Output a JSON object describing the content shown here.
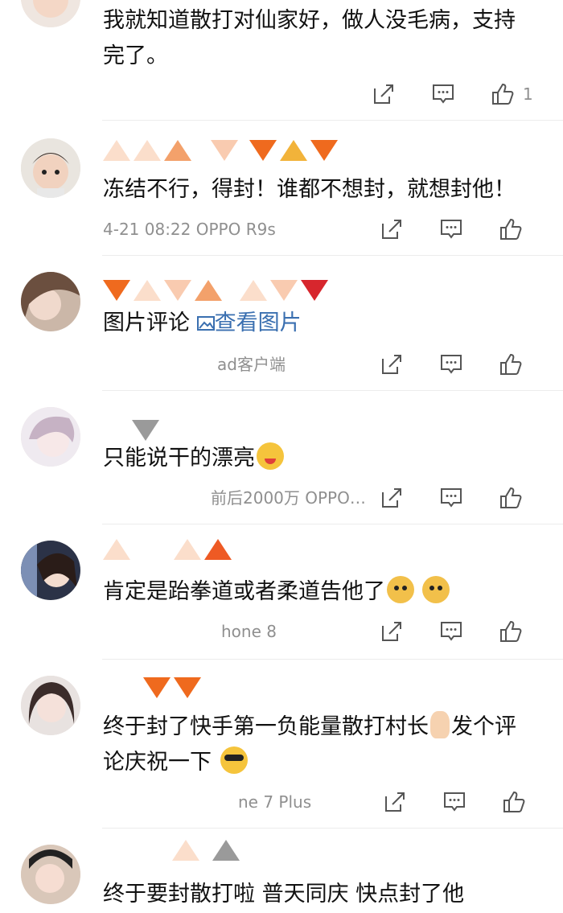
{
  "comments": [
    {
      "text_lines": [
        "我就知道散打对仙家好，做人没毛病，支持",
        "完了。"
      ],
      "meta": "",
      "like_count": "1"
    },
    {
      "text_lines": [
        "冻结不行，得封！谁都不想封，就想封他！"
      ],
      "meta": "4-21 08:22  OPPO R9s",
      "like_count": ""
    },
    {
      "text_lines": [
        "图片评论"
      ],
      "link_text": "查看图片",
      "meta": "ad客户端",
      "like_count": ""
    },
    {
      "text_lines": [
        "只能说干的漂亮"
      ],
      "meta": "前后2000万  OPPO…",
      "like_count": ""
    },
    {
      "text_lines": [
        "肯定是跆拳道或者柔道告他了"
      ],
      "meta": "hone 8",
      "like_count": ""
    },
    {
      "text_lines": [
        "终于封了快手第一负能量散打村长",
        "发个评",
        "论庆祝一下"
      ],
      "meta": "ne 7 Plus",
      "like_count": ""
    },
    {
      "text_lines": [
        "终于要封散打啦  普天同庆  快点封了他"
      ],
      "meta": "",
      "like_count": ""
    }
  ],
  "icons": {
    "share": "share-icon",
    "comment": "comment-icon",
    "like": "thumbs-up-icon",
    "image": "image-icon"
  },
  "colors": {
    "link": "#3a6fb0",
    "meta": "#8f8f8f",
    "divider": "#ececec"
  }
}
